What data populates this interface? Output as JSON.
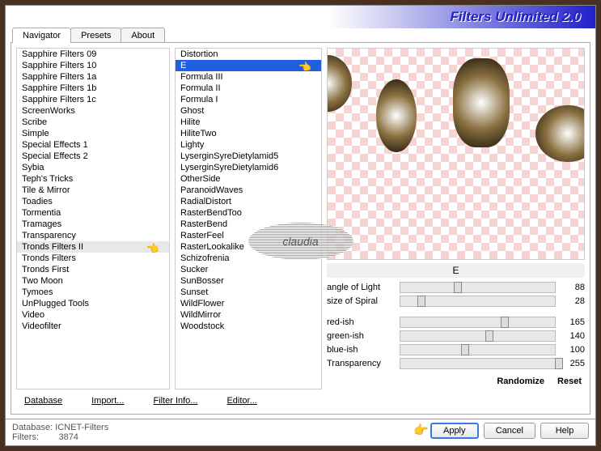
{
  "title": "Filters Unlimited 2.0",
  "tabs": [
    "Navigator",
    "Presets",
    "About"
  ],
  "listA": [
    "Sapphire Filters 09",
    "Sapphire Filters 10",
    "Sapphire Filters 1a",
    "Sapphire Filters 1b",
    "Sapphire Filters 1c",
    "ScreenWorks",
    "Scribe",
    "Simple",
    "Special Effects 1",
    "Special Effects 2",
    "Sybia",
    "Teph's Tricks",
    "Tile & Mirror",
    "Toadies",
    "Tormentia",
    "Tramages",
    "Transparency",
    "Tronds Filters II",
    "Tronds Filters",
    "Tronds First",
    "Two Moon",
    "Tymoes",
    "UnPlugged Tools",
    "Video",
    "Videofilter"
  ],
  "listA_selected": 17,
  "listB": [
    "Distortion",
    "E",
    "Formula III",
    "Formula II",
    "Formula I",
    "Ghost",
    "Hilite",
    "HiliteTwo",
    "Lighty",
    "LyserginSyreDietylamid5",
    "LyserginSyreDietylamid6",
    "OtherSide",
    "ParanoidWaves",
    "RadialDistort",
    "RasterBendToo",
    "RasterBend",
    "RasterFeel",
    "RasterLookalike",
    "Schizofrenia",
    "Sucker",
    "SunBosser",
    "Sunset",
    "WildFlower",
    "WildMirror",
    "Woodstock"
  ],
  "listB_selected": 1,
  "filterName": "E",
  "sliders1": [
    {
      "label": "angle of Light",
      "value": 88,
      "max": 255
    },
    {
      "label": "size of Spiral",
      "value": 28,
      "max": 255
    }
  ],
  "sliders2": [
    {
      "label": "red-ish",
      "value": 165,
      "max": 255
    },
    {
      "label": "green-ish",
      "value": 140,
      "max": 255
    },
    {
      "label": "blue-ish",
      "value": 100,
      "max": 255
    },
    {
      "label": "Transparency",
      "value": 255,
      "max": 255
    }
  ],
  "links": {
    "database": "Database",
    "import": "Import...",
    "filterinfo": "Filter Info...",
    "editor": "Editor...",
    "randomize": "Randomize",
    "reset": "Reset"
  },
  "footer": {
    "dbLabel": "Database:",
    "dbValue": "ICNET-Filters",
    "filtersLabel": "Filters:",
    "filtersValue": "3874"
  },
  "buttons": {
    "apply": "Apply",
    "cancel": "Cancel",
    "help": "Help"
  },
  "watermark": "claudia"
}
